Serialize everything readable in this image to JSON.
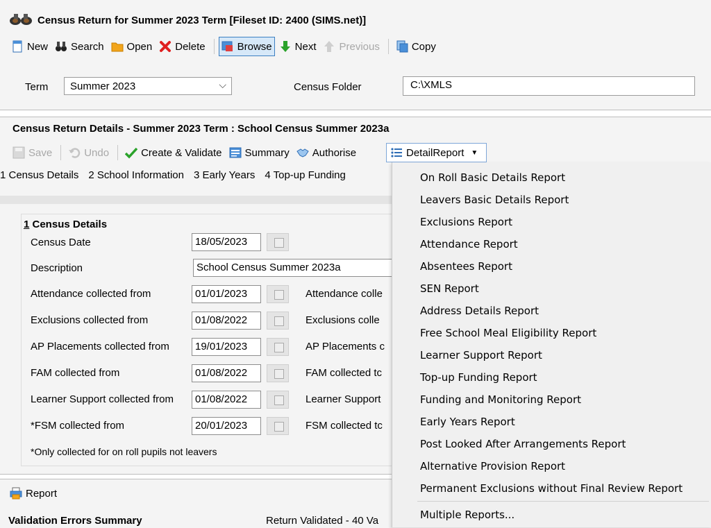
{
  "window": {
    "title": "Census Return for Summer 2023 Term [Fileset ID:  2400 (SIMS.net)]"
  },
  "toolbar": {
    "new_label": "New",
    "search_label": "Search",
    "open_label": "Open",
    "delete_label": "Delete",
    "browse_label": "Browse",
    "next_label": "Next",
    "previous_label": "Previous",
    "copy_label": "Copy"
  },
  "filters": {
    "term_label": "Term",
    "term_value": "Summer 2023",
    "folder_label": "Census Folder",
    "folder_value": "C:\\XMLS"
  },
  "details": {
    "title": "Census Return Details - Summer 2023 Term : School Census Summer 2023a",
    "toolbar": {
      "save_label": "Save",
      "undo_label": "Undo",
      "create_validate_label": "Create & Validate",
      "summary_label": "Summary",
      "authorise_label": "Authorise",
      "detail_report_label": "DetailReport"
    },
    "tabs": [
      "1 Census Details",
      "2 School Information",
      "3 Early Years",
      "4 Top-up Funding"
    ],
    "section": {
      "number": "1",
      "heading": " Census Details",
      "census_date_label": "Census Date",
      "census_date_value": "18/05/2023",
      "description_label": "Description",
      "description_value": "School Census Summer 2023a",
      "rows": [
        {
          "label": "Attendance collected from",
          "value": "01/01/2023",
          "right_label": "Attendance colle"
        },
        {
          "label": "Exclusions collected from",
          "value": "01/08/2022",
          "right_label": "Exclusions colle"
        },
        {
          "label": "AP Placements collected from",
          "value": "19/01/2023",
          "right_label": "AP Placements c"
        },
        {
          "label": "FAM collected from",
          "value": "01/08/2022",
          "right_label": "FAM collected tc"
        },
        {
          "label": "Learner Support collected from",
          "value": "01/08/2022",
          "right_label": "Learner Support"
        },
        {
          "label": "*FSM collected from",
          "value": "20/01/2023",
          "right_label": "FSM collected tc"
        }
      ],
      "footnote": "*Only collected for on roll pupils not leavers"
    }
  },
  "bottom": {
    "report_label": "Report",
    "validation_title": "Validation Errors Summary",
    "validation_status": "Return Validated - 40 Va"
  },
  "detail_menu": {
    "items": [
      "On Roll Basic Details Report",
      "Leavers Basic Details Report",
      "Exclusions Report",
      "Attendance Report",
      "Absentees Report",
      "SEN Report",
      "Address Details Report",
      "Free School Meal Eligibility Report",
      "Learner Support Report",
      "Top-up Funding Report",
      "Funding and Monitoring Report",
      "Early Years Report",
      "Post Looked After Arrangements Report",
      "Alternative Provision Report",
      "Permanent Exclusions without Final Review Report"
    ],
    "multiple_label": "Multiple Reports..."
  },
  "icons": {
    "app": "binoculars-icon",
    "new": "new-document-icon",
    "search": "binoculars-icon",
    "open": "folder-icon",
    "delete": "red-x-icon",
    "browse": "browse-icon",
    "next": "green-down-arrow-icon",
    "previous": "up-arrow-icon",
    "copy": "copy-icon"
  },
  "colors": {
    "accent": "#3c7fc1",
    "panel": "#f4f4f4",
    "folder": "#f2a51c",
    "delete": "#e02020",
    "next": "#2aa22a"
  }
}
